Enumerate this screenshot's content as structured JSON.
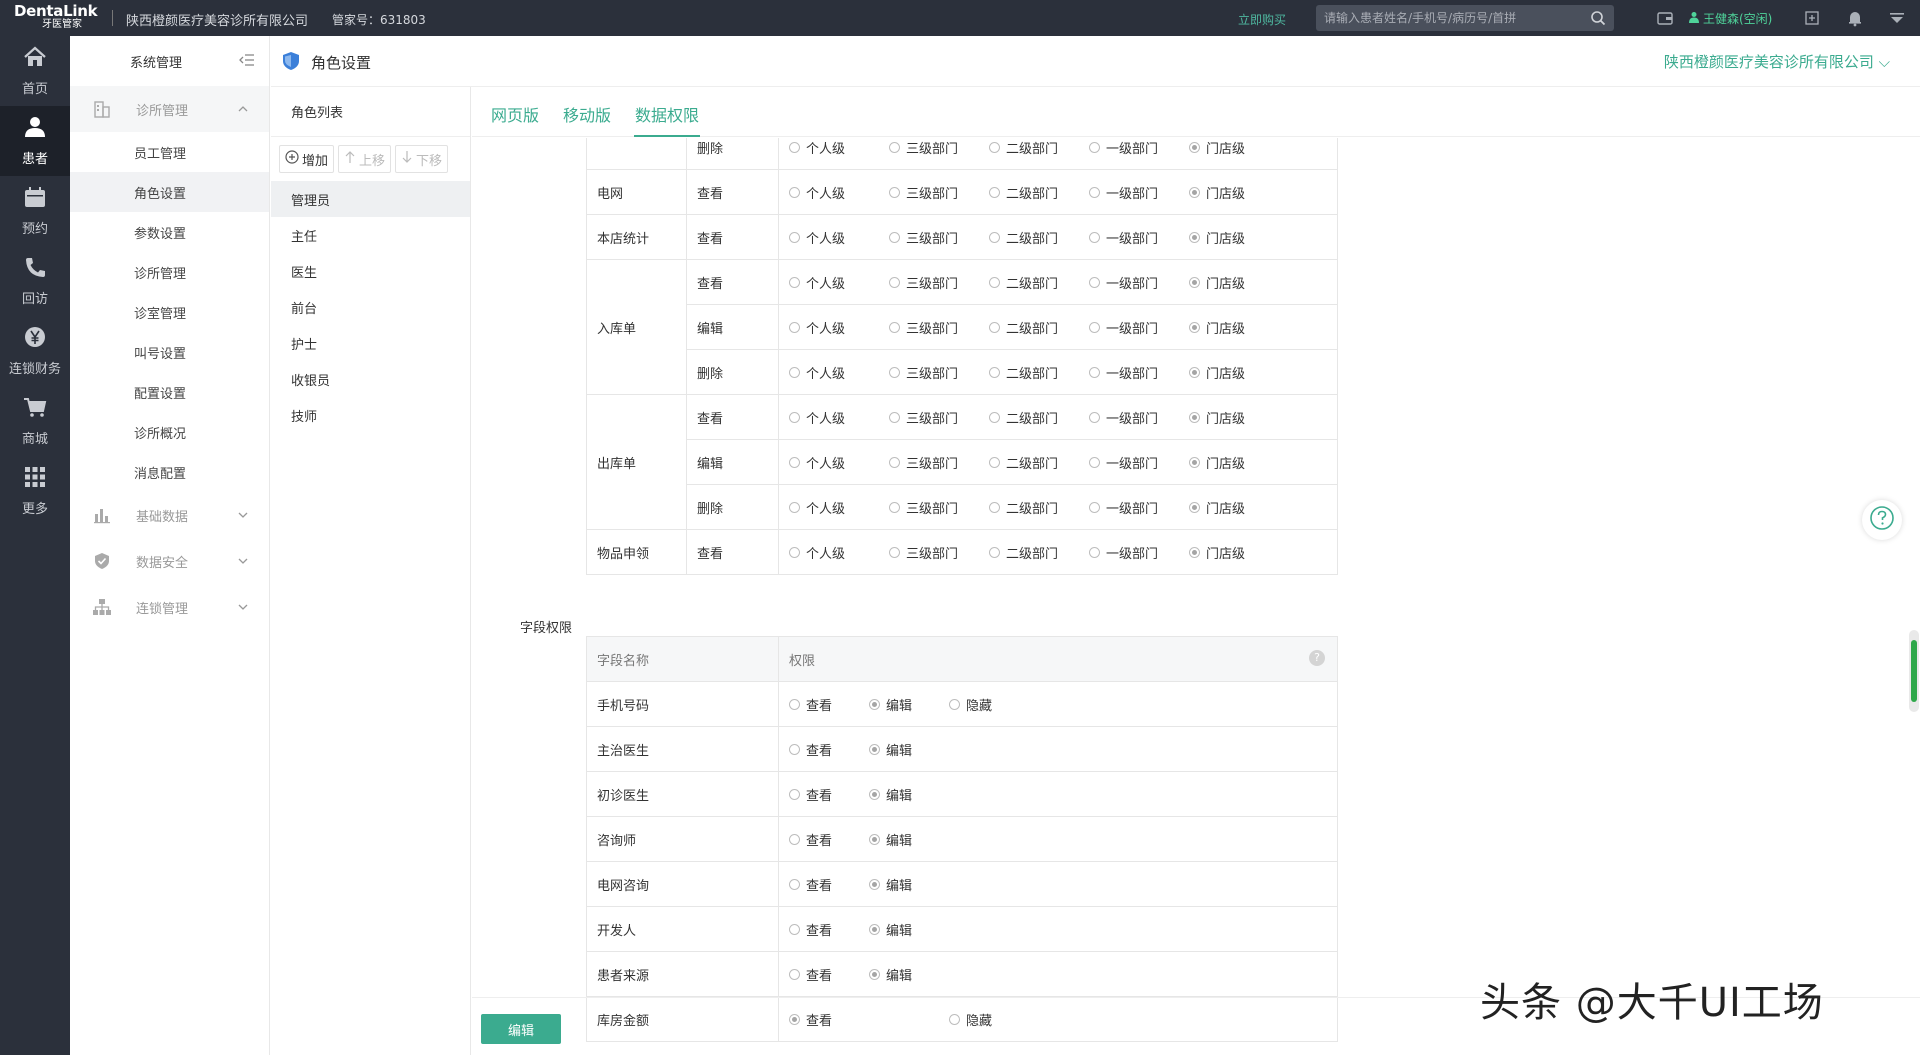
{
  "topbar": {
    "brand_name": "DentaLink",
    "brand_sub": "牙医管家",
    "company": "陕西橙颜医疗美容诊所有限公司",
    "account": "管家号：631803",
    "buy_now": "立即购买",
    "search_placeholder": "请输入患者姓名/手机号/病历号/首拼",
    "user_name": "王健森(空闲)"
  },
  "leftnav": [
    {
      "label": "首页",
      "icon": "home-icon"
    },
    {
      "label": "患者",
      "icon": "patient-icon",
      "active": true
    },
    {
      "label": "预约",
      "icon": "calendar-icon"
    },
    {
      "label": "回访",
      "icon": "phone-icon"
    },
    {
      "label": "连锁财务",
      "icon": "yen-icon"
    },
    {
      "label": "商城",
      "icon": "cart-icon"
    },
    {
      "label": "更多",
      "icon": "grid-icon"
    }
  ],
  "sidebar": {
    "header": "系统管理",
    "groups": [
      {
        "label": "诊所管理",
        "items": [
          "员工管理",
          "角色设置",
          "参数设置",
          "诊所管理",
          "诊室管理",
          "叫号设置",
          "配置设置",
          "诊所概况",
          "消息配置"
        ],
        "active_item": "角色设置"
      },
      {
        "label": "基础数据"
      },
      {
        "label": "数据安全"
      },
      {
        "label": "连锁管理"
      }
    ]
  },
  "page": {
    "title": "角色设置",
    "company_dropdown": "陕西橙颜医疗美容诊所有限公司"
  },
  "roles": {
    "title": "角色列表",
    "add": "增加",
    "up": "上移",
    "down": "下移",
    "items": [
      "管理员",
      "主任",
      "医生",
      "前台",
      "护士",
      "收银员",
      "技师"
    ],
    "active": "管理员"
  },
  "tabs": [
    "网页版",
    "移动版",
    "数据权限"
  ],
  "active_tab": "数据权限",
  "levels": [
    "个人级",
    "三级部门",
    "二级部门",
    "一级部门",
    "门店级"
  ],
  "data_rows": [
    {
      "module": "",
      "action": "删除",
      "selected": "门店级"
    },
    {
      "module": "电网",
      "action": "查看",
      "selected": "门店级"
    },
    {
      "module": "本店统计",
      "action": "查看",
      "selected": "门店级"
    },
    {
      "module": "入库单",
      "actions": [
        {
          "action": "查看",
          "selected": "门店级"
        },
        {
          "action": "编辑",
          "selected": "门店级"
        },
        {
          "action": "删除",
          "selected": "门店级"
        }
      ]
    },
    {
      "module": "出库单",
      "actions": [
        {
          "action": "查看",
          "selected": "门店级"
        },
        {
          "action": "编辑",
          "selected": "门店级"
        },
        {
          "action": "删除",
          "selected": "门店级"
        }
      ]
    },
    {
      "module": "物品申领",
      "action": "查看",
      "selected": "门店级"
    }
  ],
  "field_section": {
    "label": "字段权限",
    "col_field": "字段名称",
    "col_perm": "权限",
    "help": "?",
    "rows": [
      {
        "field": "手机号码",
        "options": [
          "查看",
          "编辑",
          "隐藏"
        ],
        "selected": "编辑"
      },
      {
        "field": "主治医生",
        "options": [
          "查看",
          "编辑"
        ],
        "selected": "编辑"
      },
      {
        "field": "初诊医生",
        "options": [
          "查看",
          "编辑"
        ],
        "selected": "编辑"
      },
      {
        "field": "咨询师",
        "options": [
          "查看",
          "编辑"
        ],
        "selected": "编辑"
      },
      {
        "field": "电网咨询",
        "options": [
          "查看",
          "编辑"
        ],
        "selected": "编辑"
      },
      {
        "field": "开发人",
        "options": [
          "查看",
          "编辑"
        ],
        "selected": "编辑"
      },
      {
        "field": "患者来源",
        "options": [
          "查看",
          "编辑"
        ],
        "selected": "编辑"
      },
      {
        "field": "库房金额",
        "options": [
          "查看",
          "",
          "隐藏"
        ],
        "selected": "查看"
      }
    ]
  },
  "edit_button": "编辑",
  "watermark": "头条 @大千UI工场",
  "colors": {
    "accent": "#3bab8f",
    "topbar": "#2b303b",
    "user_online": "#4fd39a"
  }
}
